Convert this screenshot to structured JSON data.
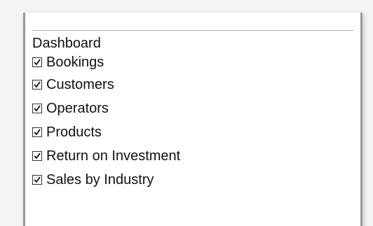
{
  "panel": {
    "title": "Dashboard",
    "items": [
      {
        "label": "Bookings",
        "checked": true
      },
      {
        "label": "Customers",
        "checked": true
      },
      {
        "label": "Operators",
        "checked": true
      },
      {
        "label": "Products",
        "checked": true
      },
      {
        "label": "Return on Investment",
        "checked": true
      },
      {
        "label": "Sales by Industry",
        "checked": true
      }
    ]
  },
  "icons": {
    "checkbox_checked": "check-icon"
  },
  "colors": {
    "panel_border": "#9a9a9a",
    "text": "#111111",
    "background": "#f4f4f4"
  }
}
